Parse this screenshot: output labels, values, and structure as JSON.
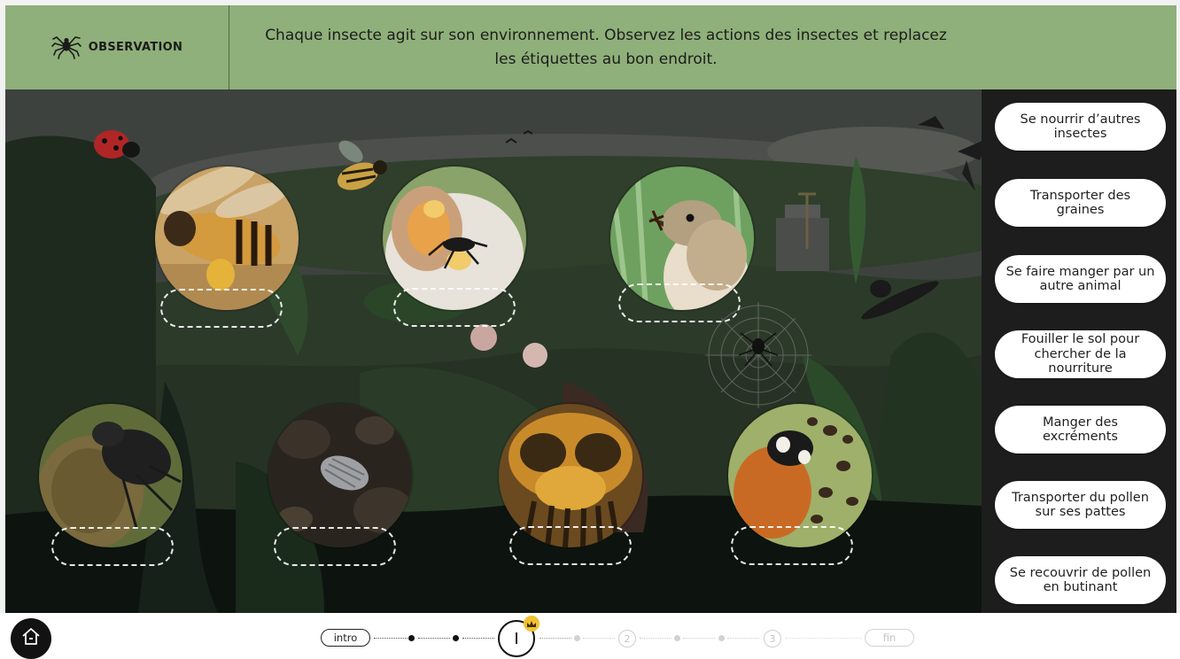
{
  "header": {
    "section_label": "OBSERVATION",
    "instruction": "Chaque insecte agit sur son environnement. Observez les actions des insectes et replacez les étiquettes au bon endroit."
  },
  "labels": [
    "Se nourrir d’autres insectes",
    "Transporter des graines",
    "Se faire manger par un autre animal",
    "Fouiller le sol pour chercher de la nourriture",
    "Manger des excréments",
    "Transporter du pollen sur ses pattes",
    "Se recouvrir de pollen en butinant"
  ],
  "photos": [
    "bee-with-pollen",
    "ant-carrying-seed",
    "bird-eating-insect",
    "dung-beetle",
    "woodlouse",
    "pollen-covered-bee",
    "ladybird-eating-aphids"
  ],
  "footer": {
    "intro": "intro",
    "current_step": "I",
    "step_2": "2",
    "step_3": "3",
    "end": "fin"
  },
  "colors": {
    "header_bg": "#8fb07a",
    "panel_bg": "#1d1d1d",
    "badge": "#f2c12e"
  }
}
